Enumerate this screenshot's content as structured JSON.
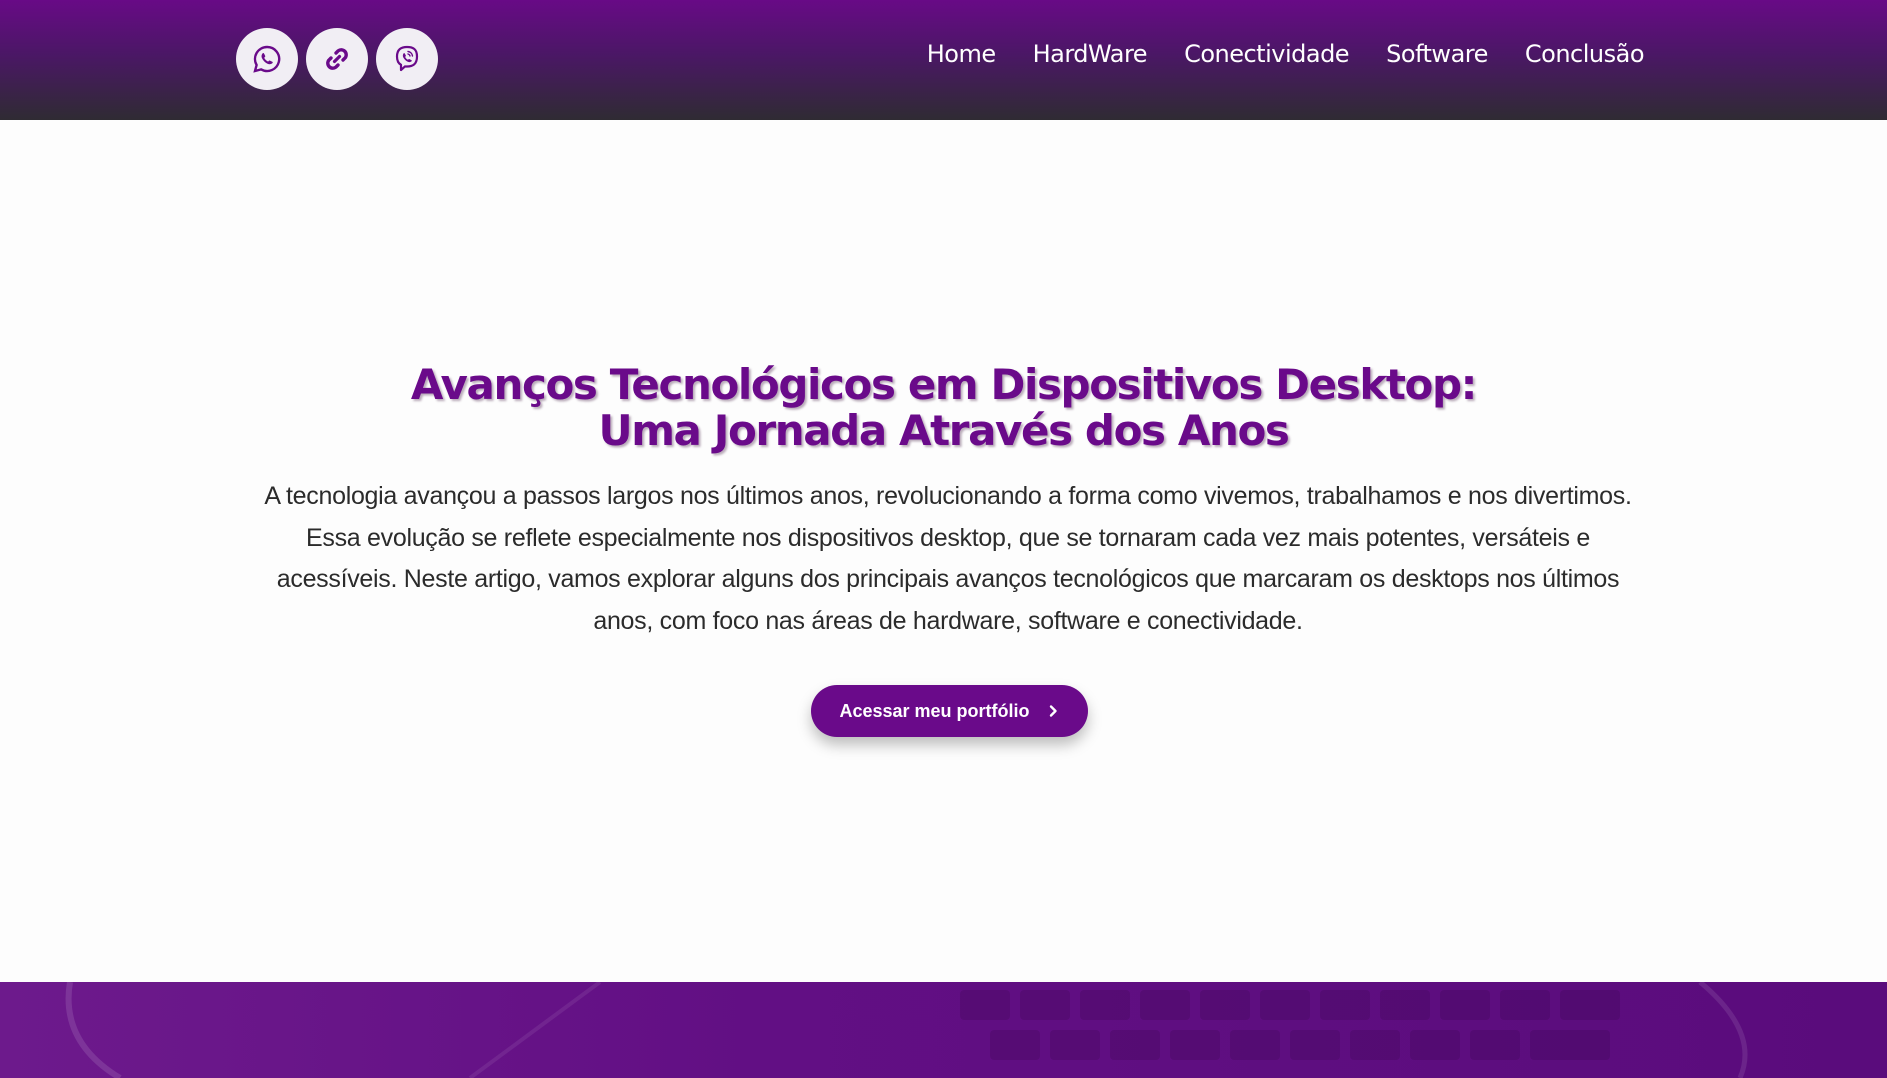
{
  "header": {
    "social": [
      {
        "name": "whatsapp-icon"
      },
      {
        "name": "link-icon"
      },
      {
        "name": "viber-icon"
      }
    ],
    "nav": [
      "Home",
      "HardWare",
      "Conectividade",
      "Software",
      "Conclusão"
    ]
  },
  "hero": {
    "title_line1": "Avanços Tecnológicos em Dispositivos Desktop:",
    "title_line2": "Uma Jornada Através dos Anos",
    "description": "A tecnologia avançou a passos largos nos últimos anos, revolucionando a forma como vivemos, trabalhamos e nos divertimos. Essa evolução se reflete especialmente nos dispositivos desktop, que se tornaram cada vez mais potentes, versáteis e acessíveis. Neste artigo, vamos explorar alguns dos principais avanços tecnológicos que marcaram os desktops nos últimos anos, com foco nas áreas de hardware, software e conectividade.",
    "cta_label": "Acessar meu portfólio"
  },
  "colors": {
    "brand_purple": "#6a0a8a",
    "header_dark": "#2f2b33",
    "icon_bg": "#f1eef4"
  }
}
